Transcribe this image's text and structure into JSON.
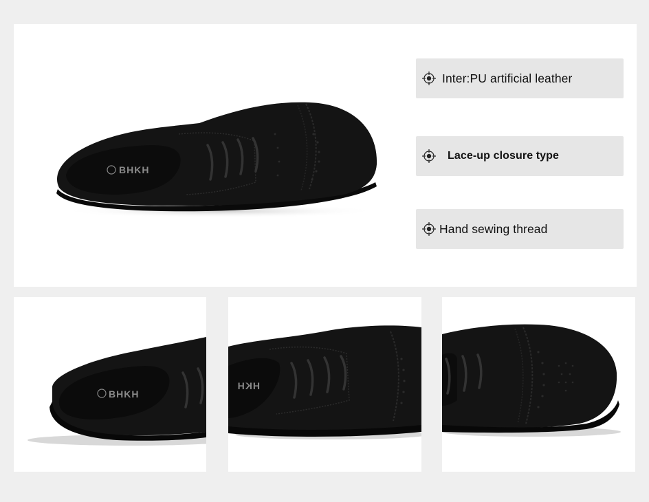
{
  "features": [
    {
      "label": "Inter:PU artificial leather",
      "icon": "target-icon"
    },
    {
      "label": "Lace-up closure type",
      "icon": "target-icon"
    },
    {
      "label": "Hand sewing thread",
      "icon": "target-icon"
    }
  ],
  "brand_logo": "BHKH",
  "colors": {
    "page_background": "#efefef",
    "panel_background": "#ffffff",
    "feature_box": "#e6e6e6",
    "shoe": "#111111"
  }
}
